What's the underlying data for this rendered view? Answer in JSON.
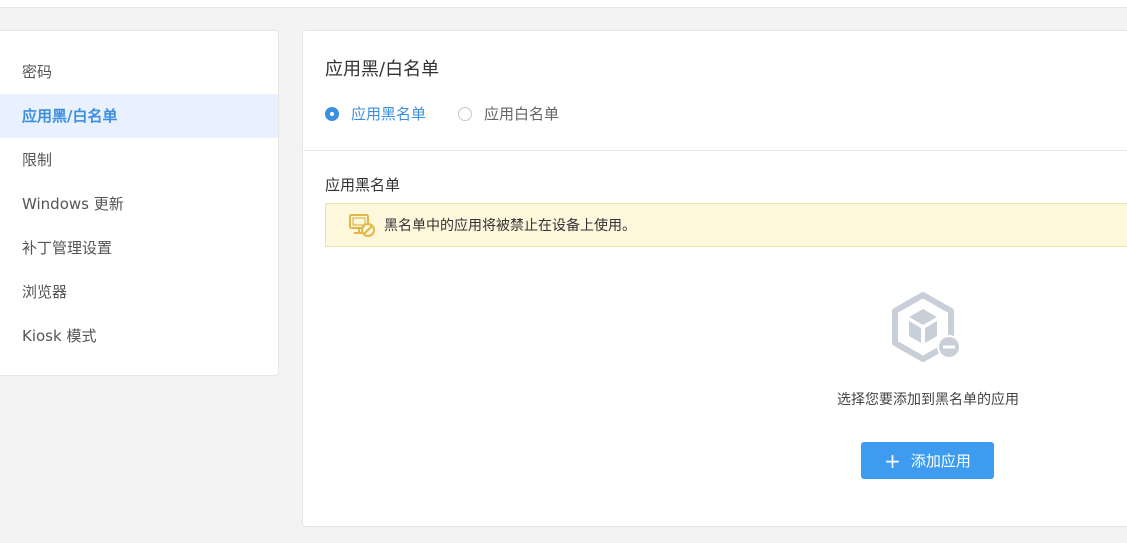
{
  "sidebar": {
    "items": [
      {
        "label": "密码"
      },
      {
        "label": "应用黑/白名单"
      },
      {
        "label": "限制"
      },
      {
        "label": "Windows 更新"
      },
      {
        "label": "补丁管理设置"
      },
      {
        "label": "浏览器"
      },
      {
        "label": "Kiosk 模式"
      }
    ],
    "active_index": 1
  },
  "main": {
    "title": "应用黑/白名单",
    "radios": [
      {
        "label": "应用黑名单",
        "checked": true
      },
      {
        "label": "应用白名单",
        "checked": false
      }
    ],
    "section_title": "应用黑名单",
    "notice": {
      "icon": "blocked-screen-icon",
      "text": "黑名单中的应用将被禁止在设备上使用。"
    },
    "empty_state": {
      "icon": "package-remove-icon",
      "text": "选择您要添加到黑名单的应用"
    },
    "add_button": {
      "icon": "plus-icon",
      "label": "添加应用"
    }
  },
  "colors": {
    "accent": "#3d8fe0",
    "button": "#3d9cf0",
    "active_bg": "#e8f1fd",
    "notice_bg": "#fdf7dc",
    "notice_icon": "#e0b84a"
  }
}
